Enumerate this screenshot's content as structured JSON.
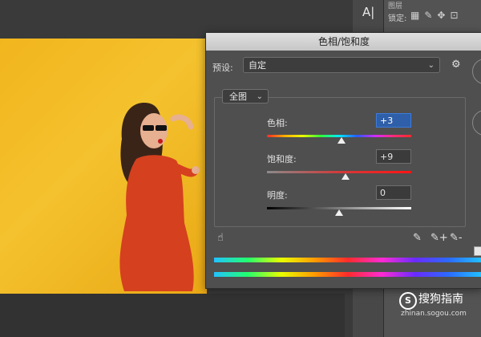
{
  "dialog": {
    "title": "色相/饱和度",
    "preset_label": "预设:",
    "preset_value": "自定",
    "channel_value": "全图",
    "hue_label": "色相:",
    "hue_value": "+3",
    "saturation_label": "饱和度:",
    "saturation_value": "+9",
    "lightness_label": "明度:",
    "lightness_value": "0",
    "slider_levels": {
      "hue": 3,
      "saturation": 9,
      "lightness": 0
    }
  },
  "workspace": {
    "text_tool_glyph": "A|",
    "lock_label": "锁定:",
    "tab_hint": "图层"
  },
  "icons": {
    "gear": "⚙",
    "chevron": "⌄",
    "hand": "☝",
    "eyedropper": "✎",
    "eyedropper_plus": "✎+",
    "eyedropper_minus": "✎-"
  },
  "watermark": {
    "logo_glyph": "S",
    "text": "搜狗指南",
    "sub": "zhinan.sogou.com"
  }
}
